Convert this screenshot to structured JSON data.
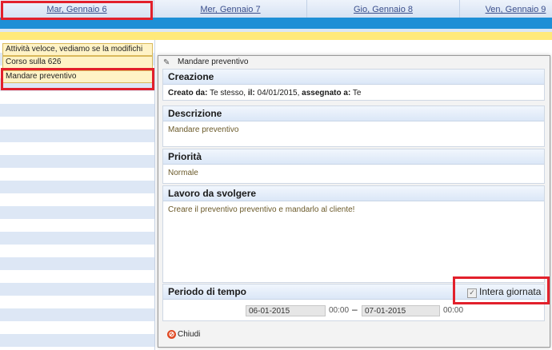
{
  "calendar": {
    "days": [
      "Mar, Gennaio 6",
      "Mer, Gennaio 7",
      "Gio, Gennaio 8",
      "Ven, Gennaio 9"
    ],
    "tasks": [
      "Attività veloce, vediamo se la modifichi",
      "Corso sulla 626",
      "Mandare preventivo"
    ]
  },
  "dialog": {
    "title": "Mandare preventivo",
    "creazione": {
      "heading": "Creazione",
      "created_by_label": "Creato da:",
      "created_by": "Te stesso,",
      "date_label": "il:",
      "date": "04/01/2015,",
      "assigned_label": "assegnato a:",
      "assigned": "Te"
    },
    "descrizione": {
      "heading": "Descrizione",
      "text": "Mandare preventivo"
    },
    "priorita": {
      "heading": "Priorità",
      "text": "Normale"
    },
    "lavoro": {
      "heading": "Lavoro da svolgere",
      "text": "Creare il preventivo preventivo e mandarlo al cliente!"
    },
    "periodo": {
      "heading": "Periodo di tempo",
      "start_date": "06-01-2015",
      "start_time": "00:00",
      "separator": "–",
      "end_date": "07-01-2015",
      "end_time": "00:00",
      "all_day_label": "Intera giornata",
      "all_day_checked": true
    },
    "close_label": "Chiudi"
  },
  "colors": {
    "highlight": "#e2202b",
    "accent_blue": "#1e8fd6",
    "task_yellow": "#fff3c6"
  }
}
